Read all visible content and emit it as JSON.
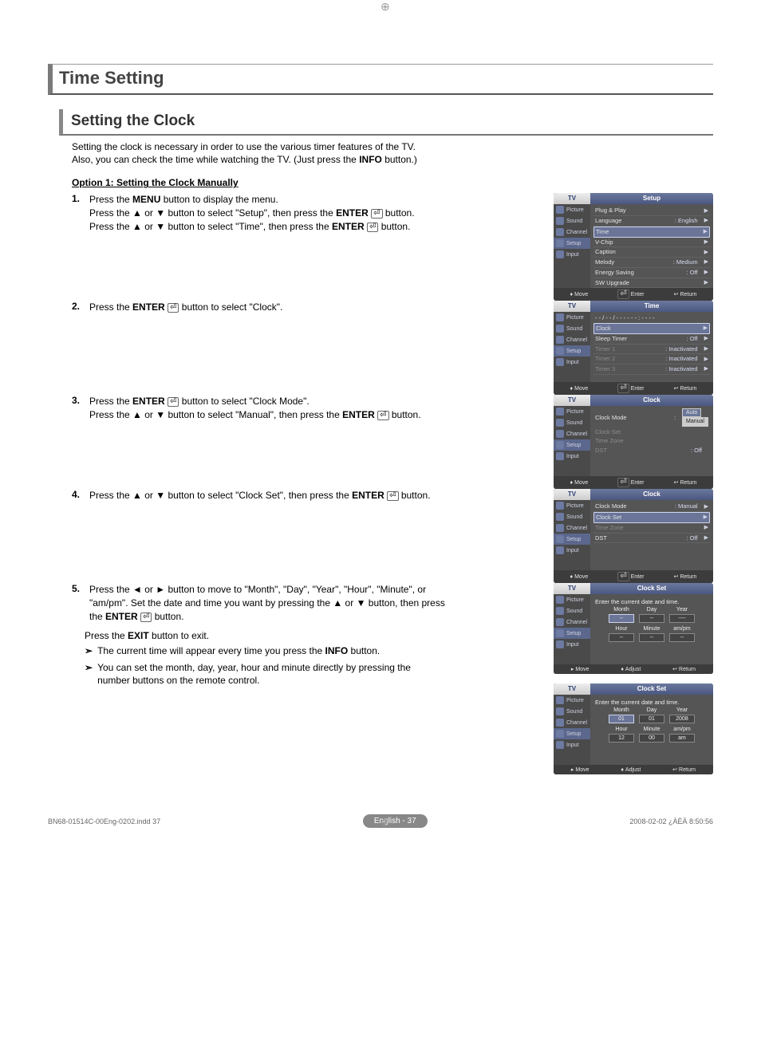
{
  "titles": {
    "main": "Time Setting",
    "sub": "Setting the Clock"
  },
  "intro": {
    "line1": "Setting the clock is necessary in order to use the various timer features of the TV.",
    "line2_a": "Also, you can check the time while watching the TV. (Just press the ",
    "line2_b": "INFO",
    "line2_c": " button.)"
  },
  "option_heading": "Option 1: Setting the Clock Manually",
  "steps": {
    "s1": {
      "num": "1.",
      "p1a": "Press the ",
      "p1b": "MENU",
      "p1c": " button to display the menu.",
      "p2a": "Press the ▲ or ▼ button to select \"Setup\", then press the ",
      "p2b": "ENTER",
      "p2c": " button.",
      "p3a": "Press the ▲ or ▼ button to select \"Time\", then press the ",
      "p3b": "ENTER",
      "p3c": " button."
    },
    "s2": {
      "num": "2.",
      "p1a": "Press the ",
      "p1b": "ENTER",
      "p1c": " button to select \"Clock\"."
    },
    "s3": {
      "num": "3.",
      "p1a": "Press the ",
      "p1b": "ENTER",
      "p1c": " button to select \"Clock Mode\".",
      "p2a": "Press the ▲ or ▼ button to select \"Manual\", then press the ",
      "p2b": "ENTER",
      "p2c": " button."
    },
    "s4": {
      "num": "4.",
      "p1a": "Press the ▲ or ▼ button to select \"Clock Set\", then press the ",
      "p1b": "ENTER",
      "p1c": " button."
    },
    "s5": {
      "num": "5.",
      "p1a": "Press the ◄ or ► button to move to \"Month\", \"Day\", \"Year\", \"Hour\", \"Minute\", or \"am/pm\". Set the date and time you want by pressing the ▲ or ▼ button, then press the ",
      "p1b": "ENTER",
      "p1c": " button.",
      "exit_a": "Press the ",
      "exit_b": "EXIT",
      "exit_c": " button to exit.",
      "note1a": "The current time will appear every time you press the ",
      "note1b": "INFO",
      "note1c": " button.",
      "note2": "You can set the month, day, year, hour and minute directly by pressing the number buttons on the remote control."
    }
  },
  "osd_common": {
    "tv": "TV",
    "side": {
      "picture": "Picture",
      "sound": "Sound",
      "channel": "Channel",
      "setup": "Setup",
      "input": "Input"
    },
    "footer": {
      "move": "Move",
      "enter": "Enter",
      "return": "Return",
      "adjust": "Adjust"
    }
  },
  "osd1": {
    "title": "Setup",
    "rows": [
      {
        "label": "Plug & Play",
        "value": ""
      },
      {
        "label": "Language",
        "value": ": English"
      },
      {
        "label": "Time",
        "value": "",
        "hl": true
      },
      {
        "label": "V-Chip",
        "value": ""
      },
      {
        "label": "Caption",
        "value": ""
      },
      {
        "label": "Melody",
        "value": ": Medium"
      },
      {
        "label": "Energy Saving",
        "value": ": Off"
      },
      {
        "label": "SW Upgrade",
        "value": ""
      }
    ]
  },
  "osd2": {
    "title": "Time",
    "header_time": "- - / - - / - - - -   - - : - -  - -",
    "rows": [
      {
        "label": "Clock",
        "value": "",
        "hl": true
      },
      {
        "label": "Sleep Timer",
        "value": ": Off"
      },
      {
        "label": "Timer 1",
        "value": ": Inactivated",
        "dim": true
      },
      {
        "label": "Timer 2",
        "value": ": Inactivated",
        "dim": true
      },
      {
        "label": "Timer 3",
        "value": ": Inactivated",
        "dim": true
      }
    ]
  },
  "osd3": {
    "title": "Clock",
    "rows": [
      {
        "label": "Clock Mode",
        "value": ":",
        "drop": [
          "Auto",
          "Manual"
        ]
      },
      {
        "label": "Clock Set",
        "value": "",
        "dim": true
      },
      {
        "label": "Time Zone",
        "value": "",
        "dim": true
      },
      {
        "label": "DST",
        "value": ": Off",
        "dim": true
      }
    ]
  },
  "osd4": {
    "title": "Clock",
    "rows": [
      {
        "label": "Clock Mode",
        "value": ": Manual"
      },
      {
        "label": "Clock Set",
        "value": "",
        "hl": true
      },
      {
        "label": "Time Zone",
        "value": "",
        "dim": true
      },
      {
        "label": "DST",
        "value": ": Off"
      }
    ]
  },
  "osd5": {
    "title": "Clock Set",
    "msg": "Enter the current date and time.",
    "row1": {
      "c1": "Month",
      "c2": "Day",
      "c3": "Year",
      "v1": "--",
      "v2": "--",
      "v3": "----"
    },
    "row2": {
      "c1": "Hour",
      "c2": "Minute",
      "c3": "am/pm",
      "v1": "--",
      "v2": "--",
      "v3": "--"
    }
  },
  "osd6": {
    "title": "Clock Set",
    "msg": "Enter the current date and time.",
    "row1": {
      "c1": "Month",
      "c2": "Day",
      "c3": "Year",
      "v1": "01",
      "v2": "01",
      "v3": "2008"
    },
    "row2": {
      "c1": "Hour",
      "c2": "Minute",
      "c3": "am/pm",
      "v1": "12",
      "v2": "00",
      "v3": "am"
    }
  },
  "page_footer": {
    "pill": "English - 37",
    "left": "BN68-01514C-00Eng-0202.indd   37",
    "right": "2008-02-02   ¿ÀÈÄ 8:50:56"
  }
}
